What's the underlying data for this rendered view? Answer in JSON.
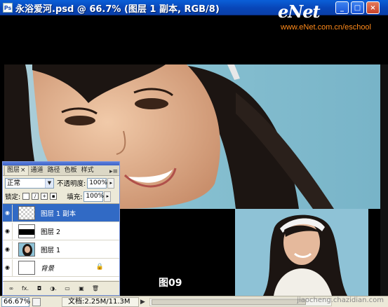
{
  "window": {
    "title": "永浴爱河.psd @ 66.7% (图层 1 副本, RGB/8)",
    "icon_label": "Ps",
    "buttons": {
      "minimize": "_",
      "maximize": "□",
      "close": "×"
    }
  },
  "watermark": {
    "logo_e": "e",
    "logo_net": "Net",
    "url": "www.eNet.com.cn/eschool"
  },
  "canvas": {
    "figure_label": "图09"
  },
  "status": {
    "zoom": "66.67%",
    "doc_info": "文档:2.25M/11.3M",
    "arrow": "▶",
    "site_mark": "jiaocheng.chazidian.com"
  },
  "layers_panel": {
    "tabs": [
      {
        "label": "图层",
        "close": "×"
      },
      {
        "label": "通道"
      },
      {
        "label": "路径"
      },
      {
        "label": "色板"
      },
      {
        "label": "样式"
      }
    ],
    "menu": "▸≡",
    "blend_mode": "正常",
    "opacity_label": "不透明度:",
    "opacity_value": "100%",
    "lock_label": "锁定:",
    "fill_label": "填充:",
    "fill_value": "100%",
    "layers": [
      {
        "name": "图层 1 副本",
        "selected": true
      },
      {
        "name": "图层 2",
        "selected": false
      },
      {
        "name": "图层 1",
        "selected": false
      },
      {
        "name": "背景",
        "selected": false,
        "locked": true
      }
    ],
    "footer_buttons": [
      "∞",
      "fx.",
      "◘",
      "◑.",
      "▭",
      "▣",
      "🗑"
    ]
  },
  "colors": {
    "title_bar": "#0a5fd8",
    "selection": "#316ac5",
    "panel_bg": "#ece9d8",
    "watermark_url": "#ff8a1a"
  }
}
